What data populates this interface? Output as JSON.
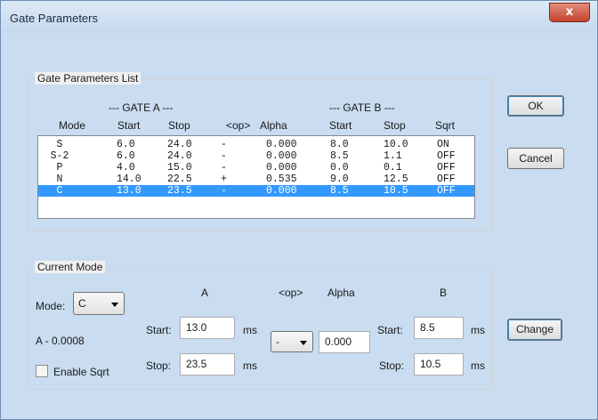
{
  "window": {
    "title": "Gate Parameters",
    "close_glyph": "x"
  },
  "list_group": {
    "title": "Gate Parameters List",
    "gate_a_header": "--- GATE A ---",
    "gate_b_header": "--- GATE B ---",
    "columns": [
      "Mode",
      "Start",
      "Stop",
      "<op>",
      "Alpha",
      "Start",
      "Stop",
      "Sqrt"
    ],
    "rows": [
      [
        "S",
        "6.0",
        "24.0",
        "-",
        "0.000",
        "8.0",
        "10.0",
        "ON"
      ],
      [
        "S-2",
        "6.0",
        "24.0",
        "-",
        "0.000",
        "8.5",
        "1.1",
        "OFF"
      ],
      [
        "P",
        "4.0",
        "15.0",
        "-",
        "0.000",
        "0.0",
        "0.1",
        "OFF"
      ],
      [
        "N",
        "14.0",
        "22.5",
        "+",
        "0.535",
        "9.0",
        "12.5",
        "OFF"
      ],
      [
        "C",
        "13.0",
        "23.5",
        "-",
        "0.000",
        "8.5",
        "10.5",
        "OFF"
      ]
    ],
    "selected_row": 4
  },
  "buttons": {
    "ok": "OK",
    "cancel": "Cancel",
    "change": "Change"
  },
  "current_mode": {
    "title": "Current Mode",
    "mode_label": "Mode:",
    "mode_value": "C",
    "a_header": "A",
    "op_header": "<op>",
    "alpha_header": "Alpha",
    "b_header": "B",
    "a_start_label": "Start:",
    "a_start_value": "13.0",
    "a_start_unit": "ms",
    "a_stop_label": "Stop:",
    "a_stop_value": "23.5",
    "a_stop_unit": "ms",
    "op_value": "-",
    "alpha_value": "0.000",
    "b_start_label": "Start:",
    "b_start_value": "8.5",
    "b_start_unit": "ms",
    "b_stop_label": "Stop:",
    "b_stop_value": "10.5",
    "b_stop_unit": "ms",
    "info_text": "A - 0.0008",
    "enable_sqrt_label": "Enable Sqrt",
    "enable_sqrt_checked": false
  }
}
